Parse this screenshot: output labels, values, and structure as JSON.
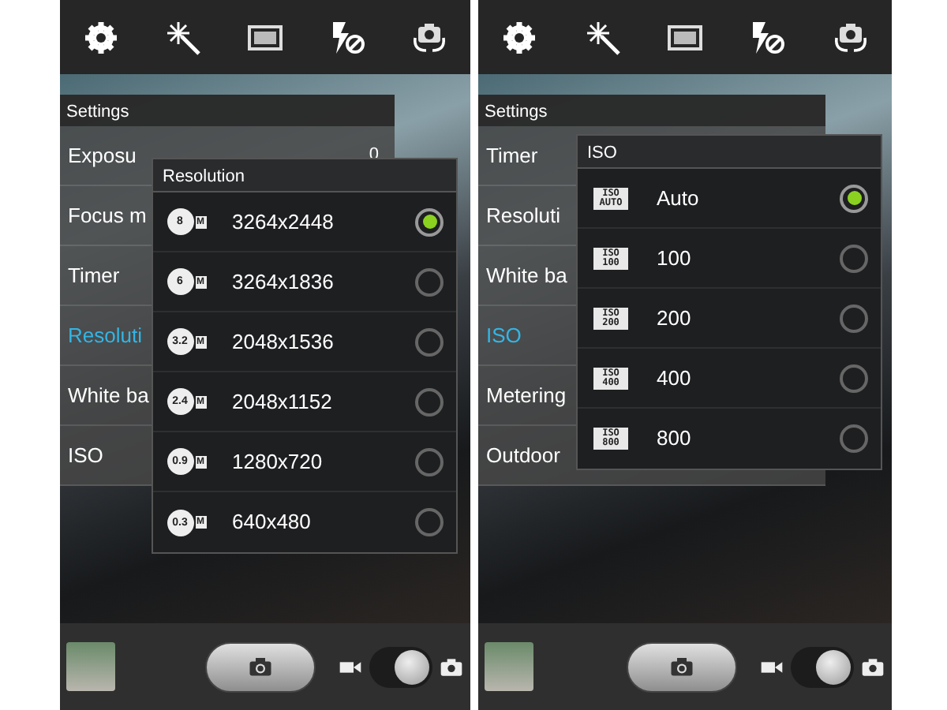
{
  "screens": [
    {
      "settings": {
        "title": "Settings",
        "items": [
          {
            "label": "Exposu",
            "value": "0",
            "selected": false
          },
          {
            "label": "Focus m",
            "selected": false
          },
          {
            "label": "Timer",
            "selected": false
          },
          {
            "label": "Resoluti",
            "selected": true
          },
          {
            "label": "White ba",
            "selected": false
          },
          {
            "label": "ISO",
            "selected": false
          }
        ]
      },
      "popup": {
        "title": "Resolution",
        "options": [
          {
            "kind": "resolution",
            "badge": "8",
            "badge_unit": "M",
            "label": "3264x2448",
            "selected": true
          },
          {
            "kind": "resolution",
            "badge": "6",
            "badge_unit": "M",
            "label": "3264x1836",
            "selected": false
          },
          {
            "kind": "resolution",
            "badge": "3.2",
            "badge_unit": "M",
            "label": "2048x1536",
            "selected": false
          },
          {
            "kind": "resolution",
            "badge": "2.4",
            "badge_unit": "M",
            "label": "2048x1152",
            "selected": false
          },
          {
            "kind": "resolution",
            "badge": "0.9",
            "badge_unit": "M",
            "label": "1280x720",
            "selected": false
          },
          {
            "kind": "resolution",
            "badge": "0.3",
            "badge_unit": "M",
            "label": "640x480",
            "selected": false
          }
        ]
      },
      "mode_switch": {
        "on": true
      }
    },
    {
      "settings": {
        "title": "Settings",
        "items": [
          {
            "label": "Timer",
            "selected": false
          },
          {
            "label": "Resoluti",
            "selected": false
          },
          {
            "label": "White ba",
            "selected": false
          },
          {
            "label": "ISO",
            "selected": true
          },
          {
            "label": "Metering",
            "selected": false
          },
          {
            "label": "Outdoor",
            "selected": false
          }
        ]
      },
      "popup": {
        "title": "ISO",
        "options": [
          {
            "kind": "iso",
            "badge": "ISO",
            "badge_unit": "AUTO",
            "label": "Auto",
            "selected": true
          },
          {
            "kind": "iso",
            "badge": "ISO",
            "badge_unit": "100",
            "label": "100",
            "selected": false
          },
          {
            "kind": "iso",
            "badge": "ISO",
            "badge_unit": "200",
            "label": "200",
            "selected": false
          },
          {
            "kind": "iso",
            "badge": "ISO",
            "badge_unit": "400",
            "label": "400",
            "selected": false
          },
          {
            "kind": "iso",
            "badge": "ISO",
            "badge_unit": "800",
            "label": "800",
            "selected": false
          }
        ]
      },
      "mode_switch": {
        "on": true
      }
    }
  ]
}
